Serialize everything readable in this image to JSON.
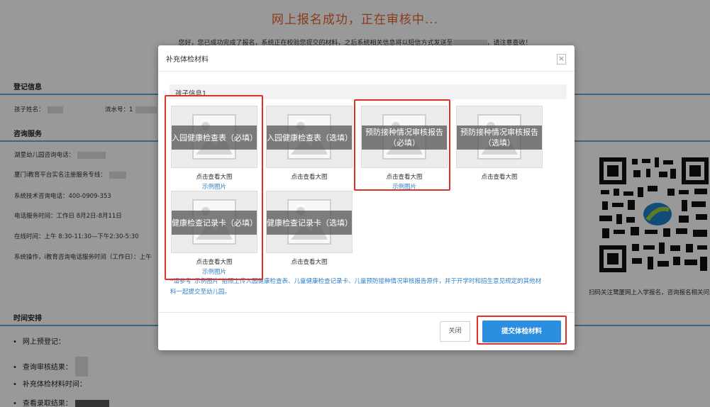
{
  "background": {
    "title": "网上报名成功，正在审核中...",
    "notice_before": "您好，您已成功完成了报名，系统正在校验您提交的材料，之后系统相关信息将以短信方式发送至",
    "notice_after": "，请注意查收！",
    "sections": {
      "register": "登记信息",
      "consult": "咨询服务",
      "schedule": "时间安排"
    },
    "register_rows": {
      "child_name": "孩子姓名：",
      "serial_no": "流水号：1"
    },
    "consult_rows": [
      "湖里幼儿园咨询电话：",
      "厦门i教育平台实名注册服务专线：",
      "系统技术咨询电话：400-0909-353",
      "电话服务时间：工作日 8月2日-8月11日",
      "在线时间：上午 8:30-11:30—下午2:30-5:30",
      "系统操作，i教育咨询电话服务时间（工作日）：上午"
    ],
    "schedule_items": [
      "网上预登记：",
      "查询审核结果：",
      "补充体检材料时间：",
      "查看录取结果："
    ],
    "qr_caption": "扫码关注鹭厦网上入学报名，咨询报名相关问题"
  },
  "modal": {
    "title": "补充体检材料",
    "close_icon": "×",
    "child_info_label": "孩子信息1",
    "cards": [
      {
        "text": "入园健康检查表（必填）",
        "view": "点击查看大图",
        "example": "示例图片"
      },
      {
        "text": "入园健康检查表（选填）",
        "view": "点击查看大图",
        "example": ""
      },
      {
        "text": "预防接种情况审核报告\n（必填）",
        "view": "点击查看大图",
        "example": "示例图片"
      },
      {
        "text": "预防接种情况审核报告\n（选填）",
        "view": "点击查看大图",
        "example": ""
      },
      {
        "text": "健康检查记录卡（必填）",
        "view": "点击查看大图",
        "example": "示例图片"
      },
      {
        "text": "健康检查记录卡（选填）",
        "view": "点击查看大图",
        "example": ""
      }
    ],
    "note_line1": "*请参考“示例图片”拍照上传入园健康检查表、儿童健康检查记录卡、儿童预防接种情况审核报告原件，并于开学时和招生意见规定的其他材",
    "note_line2": "料一起提交至幼儿园。",
    "buttons": {
      "close": "关闭",
      "submit": "提交体检材料"
    }
  },
  "colors": {
    "title_orange": "#e8632a",
    "link_blue": "#2f7fc4",
    "primary_button": "#2b8ee0",
    "highlight_red": "#e0302a"
  }
}
